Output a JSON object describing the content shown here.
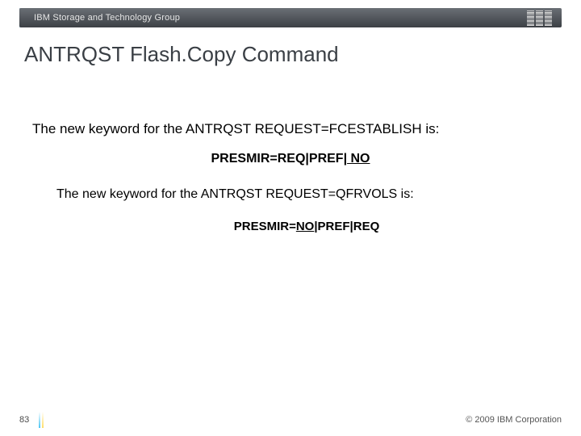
{
  "header": {
    "department": "IBM Storage and Technology Group",
    "logo_name": "ibm-logo"
  },
  "title": "ANTRQST Flash.Copy Command",
  "content": {
    "intro1": "The new keyword for the ANTRQST REQUEST=FCESTABLISH is:",
    "code1_prefix": "PRESMIR=REQ|PREF|",
    "code1_underlined": " NO",
    "intro2": "The new keyword for the ANTRQST REQUEST=QFRVOLS is:",
    "code2_prefix": "PRESMIR=",
    "code2_underlined": "NO",
    "code2_suffix": "|PREF|REQ"
  },
  "footer": {
    "page": "83",
    "copyright": "© 2009 IBM Corporation"
  }
}
